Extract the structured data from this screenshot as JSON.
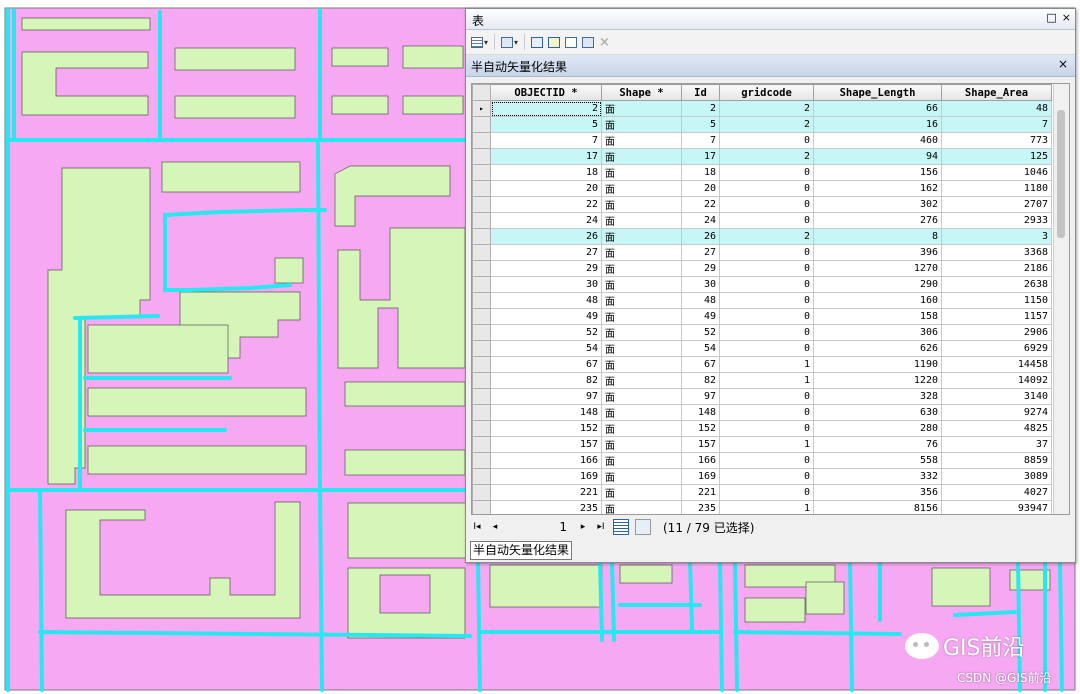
{
  "colors": {
    "map_background": "#f6a9f2",
    "building_fill": "#d6f5b8",
    "road_line": "#27e8f0",
    "selected_row": "#c7f6f6"
  },
  "window": {
    "title": "表",
    "controls": [
      "□",
      "×"
    ]
  },
  "toolbar": {
    "icons": [
      "table-options-icon",
      "related-tables-icon",
      "select-by-attributes-icon",
      "switch-selection-icon",
      "clear-selection-icon",
      "zoom-to-selected-icon",
      "delete-selected-icon"
    ]
  },
  "table_tab": {
    "name": "半自动矢量化结果",
    "close": "×"
  },
  "columns": [
    "OBJECTID *",
    "Shape *",
    "Id",
    "gridcode",
    "Shape_Length",
    "Shape_Area"
  ],
  "rows": [
    {
      "objectid": "2",
      "shape": "面",
      "id": "2",
      "gridcode": "2",
      "length": "66",
      "area": "48",
      "selected": true
    },
    {
      "objectid": "5",
      "shape": "面",
      "id": "5",
      "gridcode": "2",
      "length": "16",
      "area": "7",
      "selected": true
    },
    {
      "objectid": "7",
      "shape": "面",
      "id": "7",
      "gridcode": "0",
      "length": "460",
      "area": "773",
      "selected": false
    },
    {
      "objectid": "17",
      "shape": "面",
      "id": "17",
      "gridcode": "2",
      "length": "94",
      "area": "125",
      "selected": true
    },
    {
      "objectid": "18",
      "shape": "面",
      "id": "18",
      "gridcode": "0",
      "length": "156",
      "area": "1046",
      "selected": false
    },
    {
      "objectid": "20",
      "shape": "面",
      "id": "20",
      "gridcode": "0",
      "length": "162",
      "area": "1180",
      "selected": false
    },
    {
      "objectid": "22",
      "shape": "面",
      "id": "22",
      "gridcode": "0",
      "length": "302",
      "area": "2707",
      "selected": false
    },
    {
      "objectid": "24",
      "shape": "面",
      "id": "24",
      "gridcode": "0",
      "length": "276",
      "area": "2933",
      "selected": false
    },
    {
      "objectid": "26",
      "shape": "面",
      "id": "26",
      "gridcode": "2",
      "length": "8",
      "area": "3",
      "selected": true
    },
    {
      "objectid": "27",
      "shape": "面",
      "id": "27",
      "gridcode": "0",
      "length": "396",
      "area": "3368",
      "selected": false
    },
    {
      "objectid": "29",
      "shape": "面",
      "id": "29",
      "gridcode": "0",
      "length": "1270",
      "area": "2186",
      "selected": false
    },
    {
      "objectid": "30",
      "shape": "面",
      "id": "30",
      "gridcode": "0",
      "length": "290",
      "area": "2638",
      "selected": false
    },
    {
      "objectid": "48",
      "shape": "面",
      "id": "48",
      "gridcode": "0",
      "length": "160",
      "area": "1150",
      "selected": false
    },
    {
      "objectid": "49",
      "shape": "面",
      "id": "49",
      "gridcode": "0",
      "length": "158",
      "area": "1157",
      "selected": false
    },
    {
      "objectid": "52",
      "shape": "面",
      "id": "52",
      "gridcode": "0",
      "length": "306",
      "area": "2906",
      "selected": false
    },
    {
      "objectid": "54",
      "shape": "面",
      "id": "54",
      "gridcode": "0",
      "length": "626",
      "area": "6929",
      "selected": false
    },
    {
      "objectid": "67",
      "shape": "面",
      "id": "67",
      "gridcode": "1",
      "length": "1190",
      "area": "14458",
      "selected": false
    },
    {
      "objectid": "82",
      "shape": "面",
      "id": "82",
      "gridcode": "1",
      "length": "1220",
      "area": "14092",
      "selected": false
    },
    {
      "objectid": "97",
      "shape": "面",
      "id": "97",
      "gridcode": "0",
      "length": "328",
      "area": "3140",
      "selected": false
    },
    {
      "objectid": "148",
      "shape": "面",
      "id": "148",
      "gridcode": "0",
      "length": "630",
      "area": "9274",
      "selected": false
    },
    {
      "objectid": "152",
      "shape": "面",
      "id": "152",
      "gridcode": "0",
      "length": "280",
      "area": "4825",
      "selected": false
    },
    {
      "objectid": "157",
      "shape": "面",
      "id": "157",
      "gridcode": "1",
      "length": "76",
      "area": "37",
      "selected": false
    },
    {
      "objectid": "166",
      "shape": "面",
      "id": "166",
      "gridcode": "0",
      "length": "558",
      "area": "8859",
      "selected": false
    },
    {
      "objectid": "169",
      "shape": "面",
      "id": "169",
      "gridcode": "0",
      "length": "332",
      "area": "3089",
      "selected": false
    },
    {
      "objectid": "221",
      "shape": "面",
      "id": "221",
      "gridcode": "0",
      "length": "356",
      "area": "4027",
      "selected": false
    },
    {
      "objectid": "235",
      "shape": "面",
      "id": "235",
      "gridcode": "1",
      "length": "8156",
      "area": "93947",
      "selected": false
    }
  ],
  "row_indicator": "▸",
  "navigation": {
    "first": "I◂",
    "prev": "◂",
    "current_page": "1",
    "next": "▸",
    "last": "▸I",
    "status": "(11 / 79 已选择)"
  },
  "bottom_tab": "半自动矢量化结果",
  "watermark": {
    "brand": "GIS前沿",
    "credit": "CSDN @GIS前沿"
  }
}
